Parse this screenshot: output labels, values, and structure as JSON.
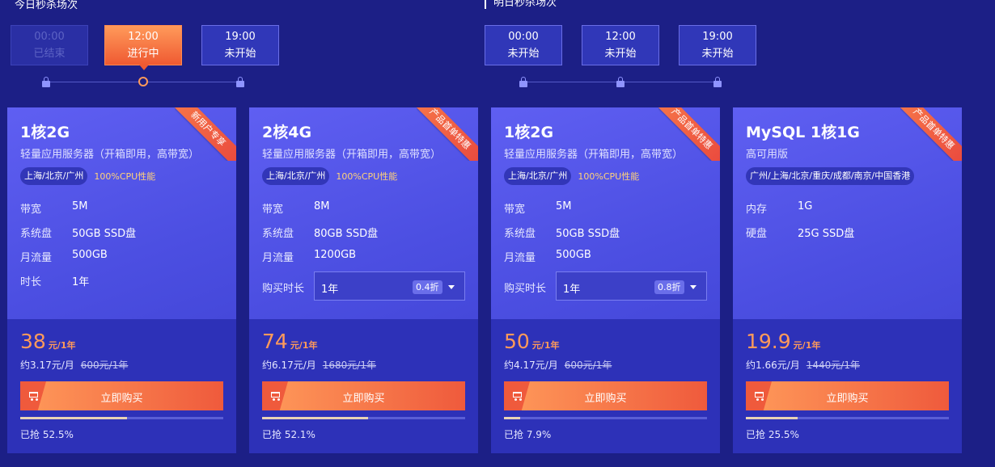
{
  "today": {
    "title": "今日秒杀场次",
    "slots": [
      {
        "time": "00:00",
        "status": "已结束",
        "state": "ended"
      },
      {
        "time": "12:00",
        "status": "进行中",
        "state": "active"
      },
      {
        "time": "19:00",
        "status": "未开始",
        "state": "upcoming"
      }
    ]
  },
  "tomorrow": {
    "title": "明日秒杀场次",
    "slots": [
      {
        "time": "00:00",
        "status": "未开始",
        "state": "upcoming"
      },
      {
        "time": "12:00",
        "status": "未开始",
        "state": "upcoming"
      },
      {
        "time": "19:00",
        "status": "未开始",
        "state": "upcoming"
      }
    ]
  },
  "cards": [
    {
      "ribbon": "新用户专享",
      "title": "1核2G",
      "subtitle": "轻量应用服务器（开箱即用，高带宽）",
      "regions": "上海/北京/广州",
      "cpu": "100%CPU性能",
      "specs": [
        {
          "key": "带宽",
          "value": "5M"
        },
        {
          "key": "系统盘",
          "value": "50GB SSD盘"
        },
        {
          "key": "月流量",
          "value": "500GB"
        },
        {
          "key": "时长",
          "value": "1年"
        }
      ],
      "price": "38",
      "price_unit": "元/1年",
      "monthly": "约3.17元/月",
      "original": "600元/1年",
      "buy_label": "立即购买",
      "sold_label": "已抢 52.5%",
      "sold_fraction": 0.525
    },
    {
      "ribbon": "产品首单特惠",
      "title": "2核4G",
      "subtitle": "轻量应用服务器（开箱即用，高带宽）",
      "regions": "上海/北京/广州",
      "cpu": "100%CPU性能",
      "specs": [
        {
          "key": "带宽",
          "value": "8M"
        },
        {
          "key": "系统盘",
          "value": "80GB SSD盘"
        },
        {
          "key": "月流量",
          "value": "1200GB"
        }
      ],
      "duration_label": "购买时长",
      "duration_value": "1年",
      "discount": "0.4折",
      "price": "74",
      "price_unit": "元/1年",
      "monthly": "约6.17元/月",
      "original": "1680元/1年",
      "buy_label": "立即购买",
      "sold_label": "已抢 52.1%",
      "sold_fraction": 0.521
    },
    {
      "ribbon": "产品首单特惠",
      "title": "1核2G",
      "subtitle": "轻量应用服务器（开箱即用，高带宽）",
      "regions": "上海/北京/广州",
      "cpu": "100%CPU性能",
      "specs": [
        {
          "key": "带宽",
          "value": "5M"
        },
        {
          "key": "系统盘",
          "value": "50GB SSD盘"
        },
        {
          "key": "月流量",
          "value": "500GB"
        }
      ],
      "duration_label": "购买时长",
      "duration_value": "1年",
      "discount": "0.8折",
      "price": "50",
      "price_unit": "元/1年",
      "monthly": "约4.17元/月",
      "original": "600元/1年",
      "buy_label": "立即购买",
      "sold_label": "已抢 7.9%",
      "sold_fraction": 0.079
    },
    {
      "ribbon": "产品首单特惠",
      "title": "MySQL 1核1G",
      "subtitle": "高可用版",
      "regions": "广州/上海/北京/重庆/成都/南京/中国香港",
      "specs": [
        {
          "key": "内存",
          "value": "1G"
        },
        {
          "key": "硬盘",
          "value": "25G SSD盘"
        }
      ],
      "price": "19.9",
      "price_unit": "元/1年",
      "monthly": "约1.66元/月",
      "original": "1440元/1年",
      "buy_label": "立即购买",
      "sold_label": "已抢 25.5%",
      "sold_fraction": 0.255
    }
  ],
  "colors": {
    "background": "#1c1f86",
    "accent_orange": "#ff9a5a",
    "card_top": "#5f5ff2",
    "card_bottom": "#2d31b8"
  }
}
